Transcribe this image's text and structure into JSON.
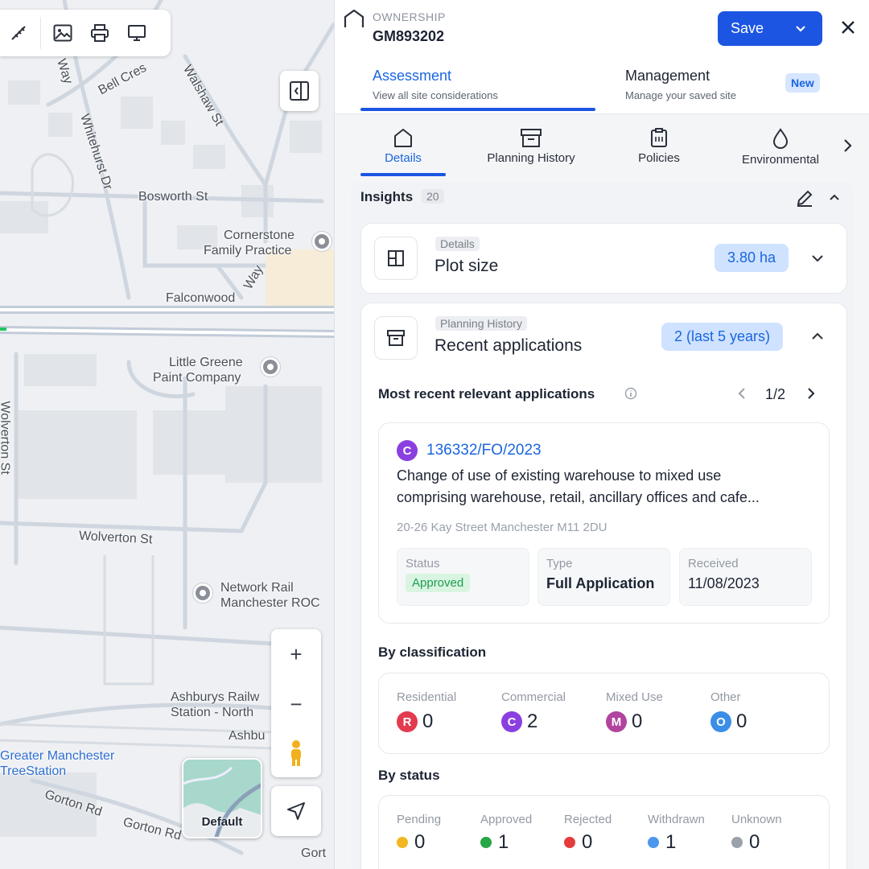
{
  "map": {
    "labels": {
      "bell_cres": "Bell Cres",
      "walshaw_st": "Walshaw St",
      "whitehurst_dr": "Whitehurst Dr",
      "bosworth_st": "Bosworth St",
      "cornerstone": "Cornerstone",
      "family_practice": "Family Practice",
      "falconwood": "Falconwood",
      "falconwood_way": "Way",
      "little_greene": "Little Greene",
      "paint_company": "Paint Company",
      "wolverton_st": "Wolverton St",
      "wolverton_st_vertical": "Wolverton St",
      "network_rail": "Network Rail",
      "manchester_roc": "Manchester ROC",
      "ashburys_railw": "Ashburys Railw",
      "station_north": "Station - North",
      "ashbu": "Ashbu",
      "greater_manchester": "Greater Manchester",
      "treestation": "TreeStation",
      "gorton_rd_1": "Gorton Rd",
      "gorton_rd_2": "Gorton Rd",
      "gort": "Gort",
      "way_top": "Way"
    },
    "default_label": "Default",
    "zoom_in": "+",
    "zoom_out": "−"
  },
  "header": {
    "ownership_label": "OWNERSHIP",
    "ownership_id": "GM893202",
    "save_label": "Save"
  },
  "tabs": [
    {
      "title": "Assessment",
      "subtitle": "View all site considerations"
    },
    {
      "title": "Management",
      "subtitle": "Manage your saved site"
    }
  ],
  "new_badge": "New",
  "subnav": [
    "Details",
    "Planning History",
    "Policies",
    "Environmental"
  ],
  "insights": {
    "title": "Insights",
    "count": "20"
  },
  "plot": {
    "category": "Details",
    "title": "Plot size",
    "value": "3.80 ha"
  },
  "planning": {
    "category": "Planning History",
    "title": "Recent applications",
    "value": "2 (last 5 years)",
    "recent_heading": "Most recent relevant applications",
    "pager": "1/2",
    "application": {
      "badge": "C",
      "ref": "136332/FO/2023",
      "description_line1": "Change of use of existing warehouse to mixed use",
      "description_line2": "comprising warehouse, retail, ancillary offices and cafe...",
      "address": "20-26 Kay Street Manchester M11 2DU",
      "status_label": "Status",
      "status_value": "Approved",
      "type_label": "Type",
      "type_value": "Full Application",
      "received_label": "Received",
      "received_value": "11/08/2023"
    },
    "classification_heading": "By classification",
    "classification": [
      {
        "label": "Residential",
        "letter": "R",
        "value": "0",
        "color": "#e23a4f"
      },
      {
        "label": "Commercial",
        "letter": "C",
        "value": "2",
        "color": "#8a3fe0"
      },
      {
        "label": "Mixed Use",
        "letter": "M",
        "value": "0",
        "color": "#b0459f"
      },
      {
        "label": "Other",
        "letter": "O",
        "value": "0",
        "color": "#3a8ee8"
      }
    ],
    "status_heading": "By status",
    "status": [
      {
        "label": "Pending",
        "value": "0",
        "color": "#f2b623"
      },
      {
        "label": "Approved",
        "value": "1",
        "color": "#26a645"
      },
      {
        "label": "Rejected",
        "value": "0",
        "color": "#e43c3c"
      },
      {
        "label": "Withdrawn",
        "value": "1",
        "color": "#4c97ee"
      },
      {
        "label": "Unknown",
        "value": "0",
        "color": "#9aa1ab"
      }
    ]
  }
}
